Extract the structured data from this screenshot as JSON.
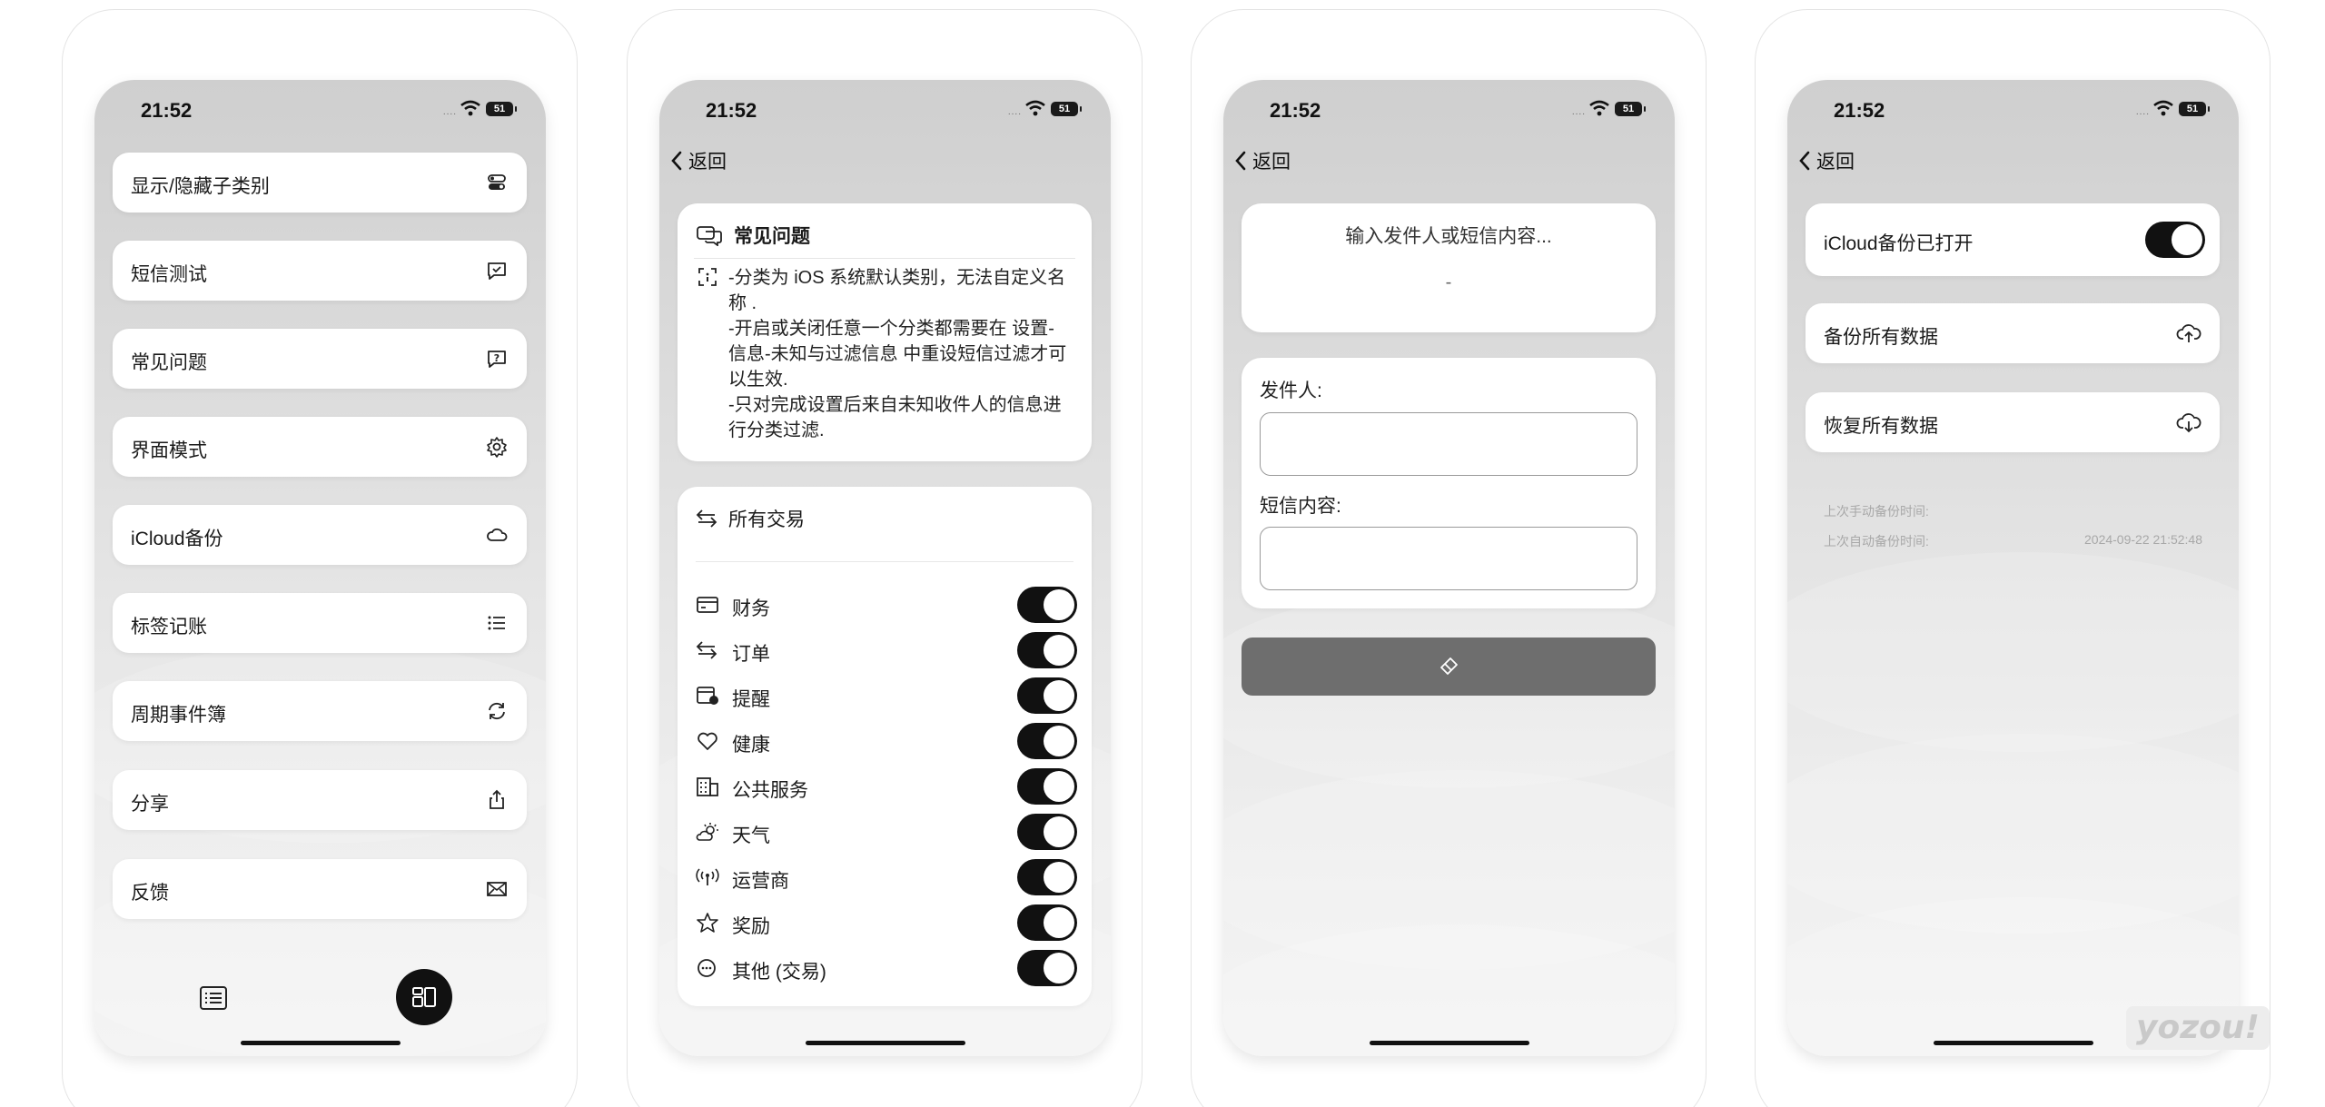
{
  "status": {
    "time": "21:52",
    "signal_dots": "....",
    "battery": "51"
  },
  "screen1": {
    "menu": [
      {
        "label": "显示/隐藏子类别",
        "icon": "toggle-icon"
      },
      {
        "label": "短信测试",
        "icon": "message-check-icon"
      },
      {
        "label": "常见问题",
        "icon": "question-bubble-icon"
      },
      {
        "label": "界面模式",
        "icon": "gear-icon"
      },
      {
        "label": "iCloud备份",
        "icon": "cloud-icon"
      },
      {
        "label": "标签记账",
        "icon": "list-icon"
      },
      {
        "label": "周期事件簿",
        "icon": "refresh-icon"
      },
      {
        "label": "分享",
        "icon": "share-icon"
      },
      {
        "label": "反馈",
        "icon": "mail-icon"
      }
    ]
  },
  "back_label": "返回",
  "screen2": {
    "faq_title": "常见问题",
    "faq_text": "-分类为 iOS 系统默认类别，无法自定义名称 .\n-开启或关闭任意一个分类都需要在 设置-信息-未知与过滤信息 中重设短信过滤才可以生效.\n-只对完成设置后来自未知收件人的信息进行分类过滤.",
    "all_transactions": "所有交易",
    "categories": [
      {
        "label": "财务",
        "icon": "card-icon",
        "on": true
      },
      {
        "label": "订单",
        "icon": "swap-icon",
        "on": true
      },
      {
        "label": "提醒",
        "icon": "calendar-badge-icon",
        "on": true
      },
      {
        "label": "健康",
        "icon": "heart-icon",
        "on": true
      },
      {
        "label": "公共服务",
        "icon": "building-icon",
        "on": true
      },
      {
        "label": "天气",
        "icon": "weather-icon",
        "on": true
      },
      {
        "label": "运营商",
        "icon": "antenna-icon",
        "on": true
      },
      {
        "label": "奖励",
        "icon": "star-icon",
        "on": true
      },
      {
        "label": "其他 (交易)",
        "icon": "more-circle-icon",
        "on": true
      }
    ]
  },
  "screen3": {
    "search_placeholder": "输入发件人或短信内容...",
    "search_result": "-",
    "sender_label": "发件人:",
    "sender_value": "",
    "content_label": "短信内容:",
    "content_value": ""
  },
  "screen4": {
    "icloud_on_label": "iCloud备份已打开",
    "icloud_on": true,
    "backup_all": "备份所有数据",
    "restore_all": "恢复所有数据",
    "last_manual_label": "上次手动备份时间:",
    "last_manual_value": "",
    "last_auto_label": "上次自动备份时间:",
    "last_auto_value": "2024-09-22 21:52:48"
  },
  "watermark": "yozou!"
}
